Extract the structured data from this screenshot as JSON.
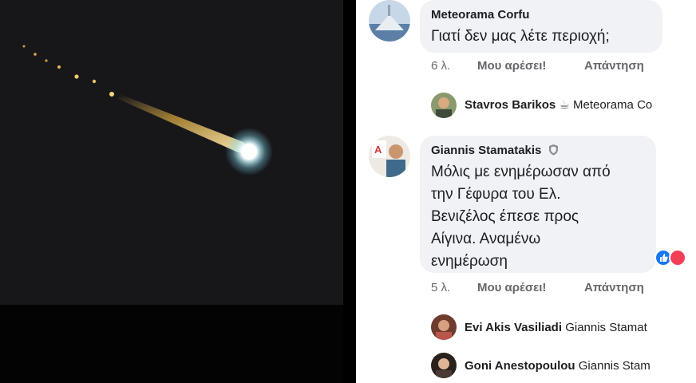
{
  "photo": {
    "alt_icon": "meteor-photo"
  },
  "comments": [
    {
      "author": "Meteorama Corfu",
      "text": "Γιατί δεν μας λέτε περιοχή;",
      "time": "6 λ.",
      "like_label": "Μου αρέσει!",
      "reply_label": "Απάντηση"
    },
    {
      "author": "Giannis Stamatakis",
      "text_lines": [
        "Μόλις με ενημέρωσαν από",
        "την Γέφυρα του Ελ.",
        "Βενιζέλος έπεσε  προς",
        "Αίγινα. Αναμένω",
        "ενημέρωση"
      ],
      "time": "5 λ.",
      "like_label": "Μου αρέσει!",
      "reply_label": "Απάντηση"
    }
  ],
  "replies": [
    {
      "author": "Stavros Barikos",
      "snippet": "Meteorama Co"
    },
    {
      "author": "Evi Akis Vasiliadi",
      "snippet": "Giannis Stamat"
    },
    {
      "author": "Goni Anestopoulou",
      "snippet": "Giannis Stam"
    }
  ],
  "colors": {
    "bubble": "#f0f2f5",
    "meta_text": "#65676b",
    "like_blue": "#1877f2"
  }
}
